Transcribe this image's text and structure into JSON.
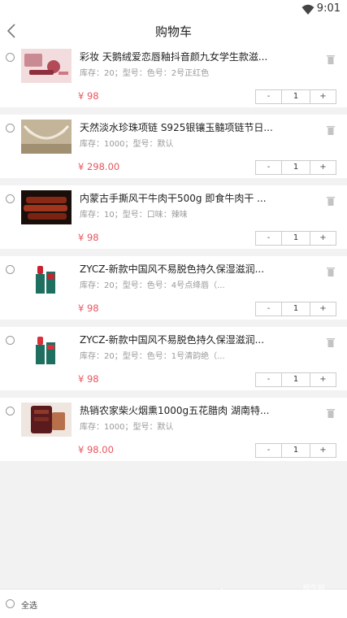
{
  "status_bar": {
    "time": "9:01"
  },
  "header": {
    "title": "购物车"
  },
  "items": [
    {
      "name": "彩妆 天鹅绒爱恋唇釉抖音颜九女学生款滋...",
      "meta": "库存：20；型号：色号：2号正红色",
      "price": "¥ 98",
      "qty": "1",
      "minus": "-",
      "plus": "+"
    },
    {
      "name": "天然淡水珍珠项链 S925银镶玉髓项链节日...",
      "meta": "库存：1000；型号：默认",
      "price": "¥ 298.00",
      "qty": "1",
      "minus": "-",
      "plus": "+"
    },
    {
      "name": "内蒙古手撕风干牛肉干500g 即食牛肉干 ...",
      "meta": "库存：10；型号：口味：辣味",
      "price": "¥ 98",
      "qty": "1",
      "minus": "-",
      "plus": "+"
    },
    {
      "name": "ZYCZ-新款中国风不易脱色持久保湿滋润...",
      "meta": "库存：20；型号：色号：4号点绛唇（...",
      "price": "¥ 98",
      "qty": "1",
      "minus": "-",
      "plus": "+"
    },
    {
      "name": "ZYCZ-新款中国风不易脱色持久保湿滋润...",
      "meta": "库存：20；型号：色号：1号清韵绝（...",
      "price": "¥ 98",
      "qty": "1",
      "minus": "-",
      "plus": "+"
    },
    {
      "name": "热销农家柴火烟熏1000g五花腊肉 湖南特...",
      "meta": "库存：1000；型号：默认",
      "price": "¥ 98.00",
      "qty": "1",
      "minus": "-",
      "plus": "+"
    }
  ],
  "footer": {
    "select_all": "全选"
  },
  "watermark": {
    "text": "CNTN.com",
    "small": "腾牛网"
  }
}
